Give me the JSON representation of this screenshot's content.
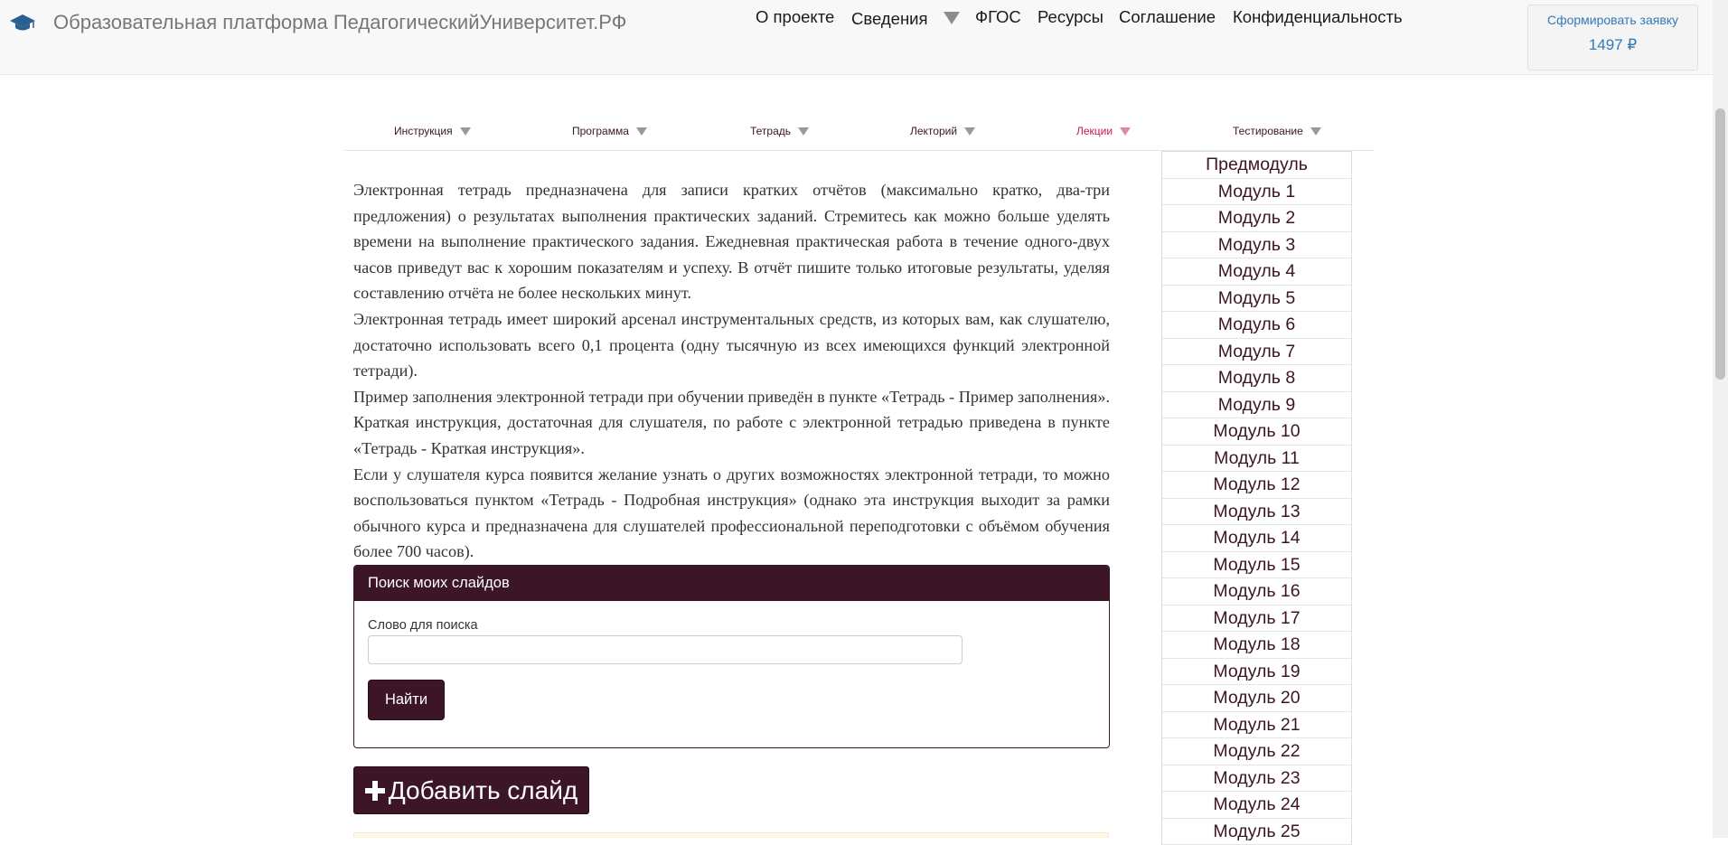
{
  "navbar": {
    "brand_icon": "graduation-cap-icon",
    "brand_title": "Образовательная платформа ПедагогическийУниверситет.РФ",
    "menu": [
      "О проекте",
      "Сведения",
      "ФГОС",
      "Ресурсы",
      "Соглашение",
      "Конфиденциальность"
    ],
    "order": {
      "label": "Сформировать заявку",
      "price": "1497 ₽"
    }
  },
  "submenu": {
    "items": [
      "Инструкция",
      "Программа",
      "Тетрадь",
      "Лекторий",
      "Лекции",
      "Тестирование"
    ],
    "active": "Лекции"
  },
  "content": {
    "paragraphs": [
      "Электронная тетрадь предназначена для записи кратких отчётов (максимально кратко, два-три предложения) о результатах выполнения практических заданий. Стремитесь как можно больше уделять времени на выполнение практического задания. Ежедневная практическая работа в течение одного-двух часов приведут вас к хорошим показателям и успеху. В отчёт пишите только итоговые результаты, уделяя составлению отчёта не более нескольких минут.",
      "Электронная тетрадь имеет широкий арсенал инструментальных средств, из которых вам, как слушателю, достаточно использовать всего 0,1 процента (одну тысячную из всех имеющихся функций электронной тетради).",
      "Пример заполнения электронной тетради при обучении приведён в пункте «Тетрадь - Пример заполнения». Краткая инструкция, достаточная для слушателя, по работе с электронной тетрадью приведена в пункте «Тетрадь - Краткая инструкция».",
      "Если у слушателя курса появится желание узнать о других возможностях электронной тетради, то можно воспользоваться пунктом «Тетрадь - Подробная инструкция» (однако эта инструкция выходит за рамки обычного курса и предназначена для слушателей профессиональной переподготовки с объёмом обучения более 700 часов)."
    ]
  },
  "search_panel": {
    "title": "Поиск моих слайдов",
    "field_label": "Слово для поиска",
    "input_value": "",
    "button": "Найти"
  },
  "add_slide": {
    "label": "Добавить слайд",
    "icon": "plus-icon"
  },
  "modules": [
    "Предмодуль",
    "Модуль 1",
    "Модуль 2",
    "Модуль 3",
    "Модуль 4",
    "Модуль 5",
    "Модуль 6",
    "Модуль 7",
    "Модуль 8",
    "Модуль 9",
    "Модуль 10",
    "Модуль 11",
    "Модуль 12",
    "Модуль 13",
    "Модуль 14",
    "Модуль 15",
    "Модуль 16",
    "Модуль 17",
    "Модуль 18",
    "Модуль 19",
    "Модуль 20",
    "Модуль 21",
    "Модуль 22",
    "Модуль 23",
    "Модуль 24",
    "Модуль 25"
  ],
  "colors": {
    "accent": "#3c1527",
    "link": "#337ab7",
    "active_submenu": "#c9184a"
  }
}
